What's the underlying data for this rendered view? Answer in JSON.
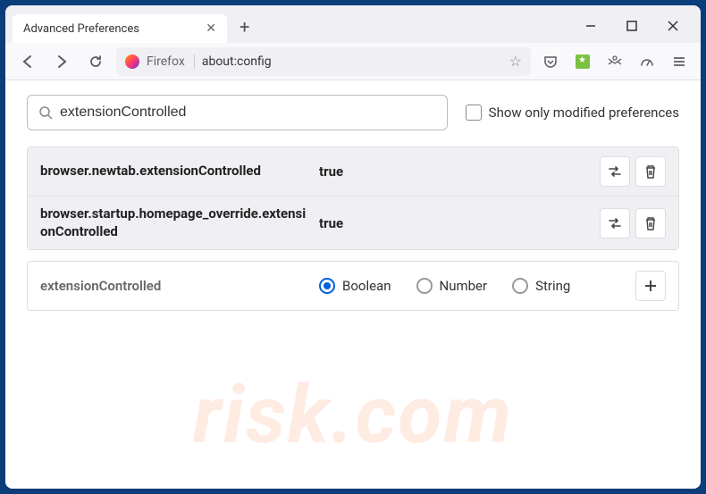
{
  "tab": {
    "title": "Advanced Preferences"
  },
  "url": {
    "prefix": "Firefox",
    "address": "about:config"
  },
  "search": {
    "value": "extensionControlled"
  },
  "modified_label": "Show only modified preferences",
  "prefs": [
    {
      "name": "browser.newtab.extensionControlled",
      "value": "true"
    },
    {
      "name": "browser.startup.homepage_override.extensionControlled",
      "value": "true"
    }
  ],
  "new_pref": {
    "name": "extensionControlled",
    "types": [
      "Boolean",
      "Number",
      "String"
    ],
    "selected": "Boolean"
  },
  "watermark": "risk.com"
}
